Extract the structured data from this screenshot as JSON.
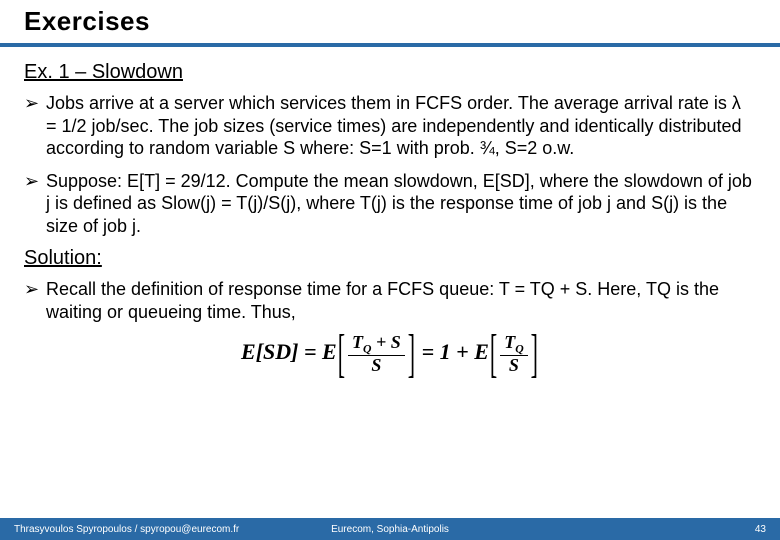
{
  "header": {
    "title": "Exercises"
  },
  "section1": {
    "title": "Ex. 1 – Slowdown"
  },
  "bullets": {
    "b1": "Jobs arrive at a server which services them in FCFS order. The average arrival rate is λ = 1/2 job/sec. The job sizes (service times) are independently and identically distributed according to random variable S where: S=1 with prob. ¾, S=2 o.w.",
    "b2": "Suppose: E[T] = 29/12. Compute the mean slowdown, E[SD], where the slowdown of job j is defined as Slow(j) = T(j)/S(j), where T(j) is the response time of job j and S(j) is the size of job j.",
    "b3": "Recall the definition of response time for a FCFS queue: T = TQ + S. Here, TQ is the waiting or queueing time. Thus,"
  },
  "section2": {
    "title": "Solution:"
  },
  "equation": {
    "lhs": "E[SD]",
    "mid_numer": "TQ + S",
    "mid_denom": "S",
    "one": "1",
    "rhs_numer": "TQ",
    "rhs_denom": "S",
    "E": "E",
    "plus": "+",
    "eq": "="
  },
  "footer": {
    "left": "Thrasyvoulos Spyropoulos / spyropou@eurecom.fr",
    "center": "Eurecom, Sophia-Antipolis",
    "right": "43"
  }
}
